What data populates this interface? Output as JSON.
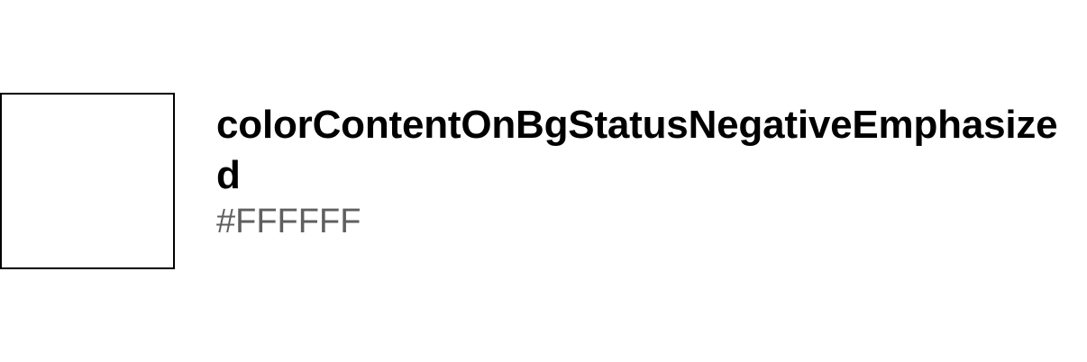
{
  "token": {
    "name": "colorContentOnBgStatusNegativeEmphasized",
    "value": "#FFFFFF",
    "swatch_color": "#FFFFFF",
    "border_color": "#000000"
  }
}
